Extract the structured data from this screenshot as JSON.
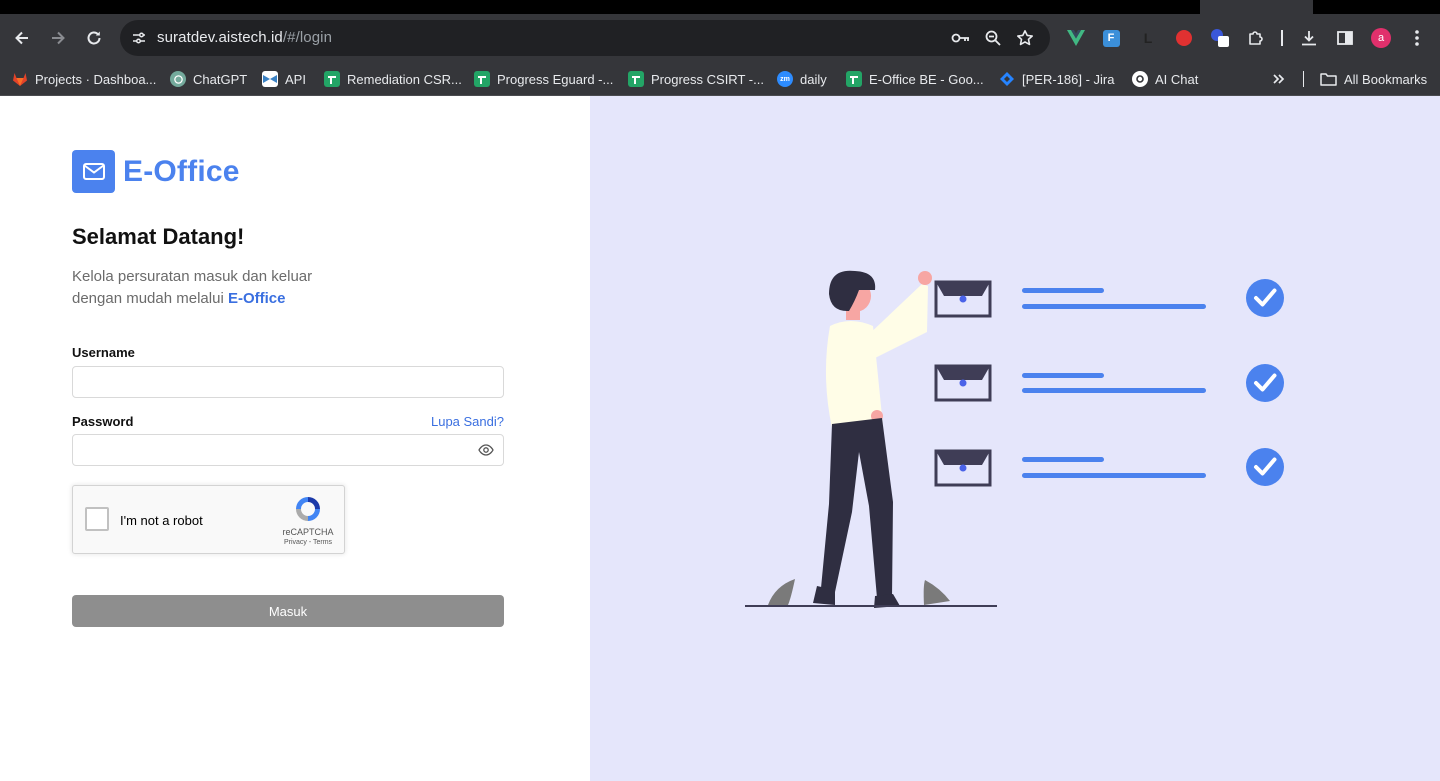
{
  "browser": {
    "url_host": "suratdev.aistech.id",
    "url_path": "/#/login",
    "profile_initial": "a",
    "bookmarks": [
      {
        "label": "Projects · Dashboa...",
        "icon": "gitlab-icon",
        "color": "#e24329"
      },
      {
        "label": "ChatGPT",
        "icon": "chatgpt-icon",
        "color": "#74aa9c"
      },
      {
        "label": "API",
        "icon": "api-icon",
        "color": "#3b82c4"
      },
      {
        "label": "Remediation CSR...",
        "icon": "sheets-icon",
        "color": "#23a566"
      },
      {
        "label": "Progress Eguard -...",
        "icon": "sheets-icon",
        "color": "#23a566"
      },
      {
        "label": "Progress CSIRT -...",
        "icon": "sheets-icon",
        "color": "#23a566"
      },
      {
        "label": "daily",
        "icon": "zoom-icon",
        "color": "#2d8cff"
      },
      {
        "label": "E-Office BE - Goo...",
        "icon": "sheets-icon",
        "color": "#23a566"
      },
      {
        "label": "[PER-186] - Jira",
        "icon": "jira-icon",
        "color": "#2684ff"
      },
      {
        "label": "AI Chat",
        "icon": "ai-chat-icon",
        "color": "#ffffff"
      }
    ],
    "all_bookmarks": "All Bookmarks"
  },
  "login": {
    "brand": "E-Office",
    "welcome": "Selamat Datang!",
    "subtitle_line1": "Kelola persuratan masuk dan keluar",
    "subtitle_line2": "dengan mudah melalui",
    "subtitle_brand": "E-Office",
    "username_label": "Username",
    "username_value": "",
    "password_label": "Password",
    "password_value": "",
    "forgot_label": "Lupa Sandi?",
    "captcha_label": "I'm not a robot",
    "captcha_brand": "reCAPTCHA",
    "captcha_links": "Privacy - Terms",
    "submit_label": "Masuk"
  },
  "colors": {
    "accent": "#4b82ee",
    "illustration_bg": "#e5e6fb",
    "button_disabled": "#8e8e8e"
  }
}
